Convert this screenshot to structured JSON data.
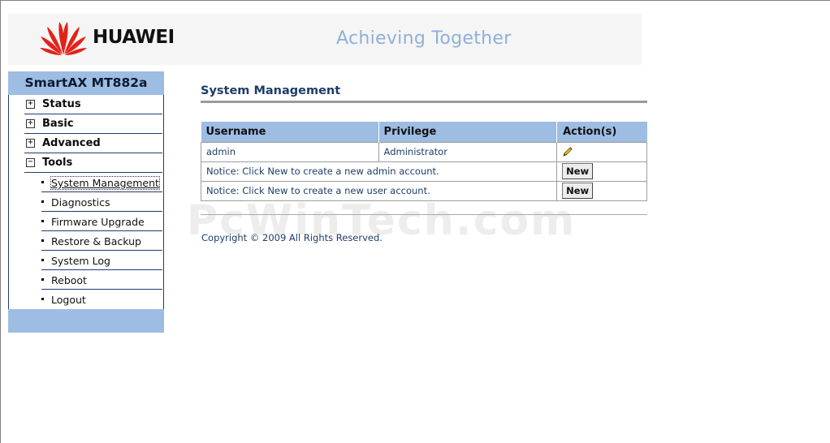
{
  "header": {
    "brand": "HUAWEI",
    "tagline": "Achieving Together",
    "logo_icon": "huawei-petal-logo",
    "logo_color": "#e2231a",
    "tagline_color": "#8fb0d8"
  },
  "sidebar": {
    "title": "SmartAX MT882a",
    "accent": "#9dbde3",
    "groups": [
      {
        "label": "Status",
        "expander": "+"
      },
      {
        "label": "Basic",
        "expander": "+"
      },
      {
        "label": "Advanced",
        "expander": "+"
      },
      {
        "label": "Tools",
        "expander": "−"
      }
    ],
    "tools_items": [
      {
        "label": "System Management",
        "active": true
      },
      {
        "label": "Diagnostics"
      },
      {
        "label": "Firmware Upgrade"
      },
      {
        "label": "Restore & Backup"
      },
      {
        "label": "System Log"
      },
      {
        "label": "Reboot"
      },
      {
        "label": "Logout"
      }
    ]
  },
  "main": {
    "title": "System Management",
    "table": {
      "headers": [
        "Username",
        "Privilege",
        "Action(s)"
      ],
      "rows": [
        {
          "username": "admin",
          "privilege": "Administrator",
          "action_icon": "edit-pencil-icon"
        }
      ],
      "notices": [
        {
          "text": "Notice: Click New to create a new admin account.",
          "button": "New"
        },
        {
          "text": "Notice: Click New to create a new user account.",
          "button": "New"
        }
      ]
    },
    "copyright": "Copyright © 2009 All Rights Reserved."
  },
  "watermark": "PcWinTech.com"
}
